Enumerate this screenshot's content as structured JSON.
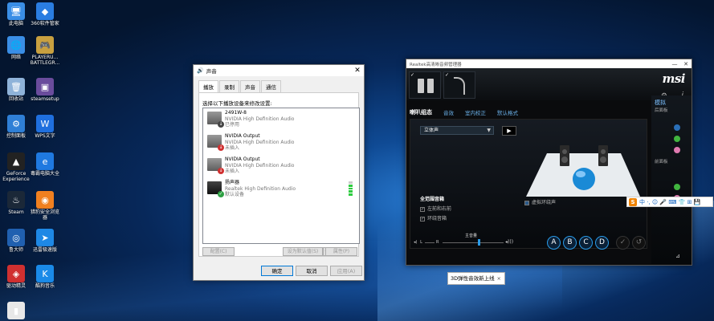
{
  "desktop_icons": [
    {
      "label": "此电脑",
      "icon": "computer-icon",
      "color": "#3a8ee6"
    },
    {
      "label": "360软件管家",
      "icon": "software-manager-icon",
      "color": "#2a7de1"
    },
    {
      "label": "网络",
      "icon": "network-icon",
      "color": "#3a8ee6"
    },
    {
      "label": "PLAYERU...\nBATTLEGR...",
      "icon": "game-icon",
      "color": "#c8a040"
    },
    {
      "label": "回收站",
      "icon": "recycle-bin-icon",
      "color": "#8fb3d9"
    },
    {
      "label": "steamsetup",
      "icon": "installer-icon",
      "color": "#6a4c9c"
    },
    {
      "label": "控制面板",
      "icon": "control-panel-icon",
      "color": "#2f7fd6"
    },
    {
      "label": "WPS文字",
      "icon": "wps-icon",
      "color": "#1f6fde"
    },
    {
      "label": "GeForce\nExperience",
      "icon": "geforce-icon",
      "color": "#222"
    },
    {
      "label": "毒霸电脑大全",
      "icon": "browser-icon",
      "color": "#1f79e0"
    },
    {
      "label": "Steam",
      "icon": "steam-icon",
      "color": "#1b2838"
    },
    {
      "label": "猎豹安全浏览器",
      "icon": "cheetah-browser-icon",
      "color": "#f08020"
    },
    {
      "label": "鲁大师",
      "icon": "ludashi-icon",
      "color": "#2060b0"
    },
    {
      "label": "迅雷极速版",
      "icon": "thunder-icon",
      "color": "#1e88e5"
    },
    {
      "label": "驱动精灵",
      "icon": "driver-icon",
      "color": "#d03030"
    },
    {
      "label": "酷狗音乐",
      "icon": "kugou-icon",
      "color": "#1a8ae8"
    },
    {
      "label": "",
      "icon": "file-icon",
      "color": "#e8e8e8"
    }
  ],
  "sound_dialog": {
    "title": "声音",
    "tabs": [
      "播放",
      "录制",
      "声音",
      "通信"
    ],
    "instruction": "选择以下播放设备来修改设置:",
    "devices": [
      {
        "name": "2491W-8",
        "driver": "NVIDIA High Definition Audio",
        "status": "已停用",
        "status_icon": "disabled-arrow-icon",
        "status_color": "#444"
      },
      {
        "name": "NVIDIA Output",
        "driver": "NVIDIA High Definition Audio",
        "status": "未插入",
        "status_icon": "unplugged-icon",
        "status_color": "#d03030"
      },
      {
        "name": "NVIDIA Output",
        "driver": "NVIDIA High Definition Audio",
        "status": "未插入",
        "status_icon": "unplugged-icon",
        "status_color": "#d03030"
      },
      {
        "name": "扬声器",
        "driver": "Realtek High Definition Audio",
        "status": "默认设备",
        "status_icon": "check-icon",
        "status_color": "#2ea043"
      }
    ],
    "configure_label": "配置(C)",
    "set_default_label": "设为默认值(S)",
    "properties_label": "属性(P)",
    "ok_label": "确定",
    "cancel_label": "取消",
    "apply_label": "应用(A)"
  },
  "realtek": {
    "title": "Realtek高清晰音频管理器",
    "brand": "msi",
    "tabs": [
      "喇叭组态",
      "音效",
      "室内校正",
      "默认格式"
    ],
    "speaker_config": "立体声",
    "side_label": "模拟",
    "side_sub1": "后面板",
    "side_sub2": "前面板",
    "fullrange_title": "全范围音箱",
    "fullrange_opt1": "左前和右前",
    "fullrange_opt2": "环绕音箱",
    "virtual_surround": "虚拟环绕声",
    "volume_main_label": "主音量",
    "vol_left": "L",
    "vol_right": "R",
    "round_buttons": [
      "A",
      "B",
      "C",
      "D"
    ]
  },
  "tooltip": {
    "text": "3D弹性音效新上线",
    "close": "×"
  },
  "ime_bar": {
    "logo": "S",
    "items": "中 ·, ☺ 🎤 ⌨ 👕 ⊞ 💾"
  }
}
